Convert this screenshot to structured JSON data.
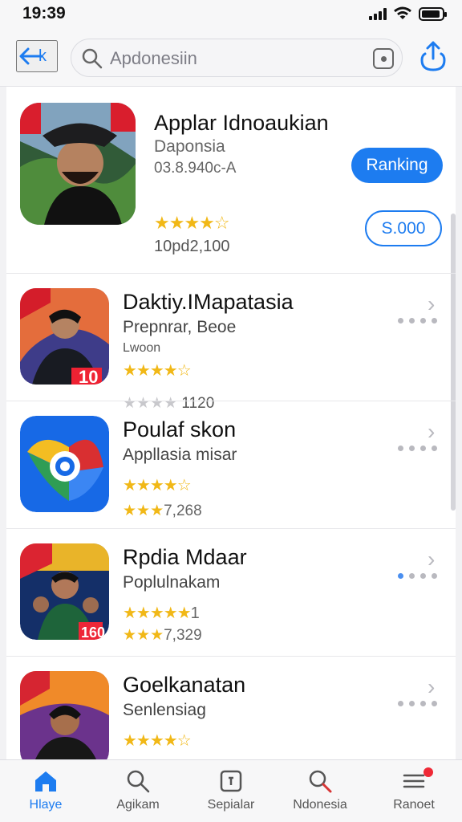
{
  "status_bar": {
    "time": "19:39"
  },
  "nav": {
    "back_label": "k",
    "search_value": "Apdonesiin"
  },
  "featured_app": {
    "title": "Applar Idnoaukian",
    "subtitle": "Daponsia",
    "code": "03.8.940c-A",
    "stars": "★★★★☆",
    "rating_count": "10pd2,100",
    "primary_action": "Ranking",
    "secondary_action": "S.000"
  },
  "apps": [
    {
      "title": "Daktiy.IMapatasia",
      "subtitle": "Prepnrar, Beoe",
      "detail": "Lwoon",
      "stars": "★★★★☆",
      "count_stars": "★★★★",
      "count": "1120"
    },
    {
      "title": "Poulaf skon",
      "subtitle": "Appllasia misar",
      "stars": "★★★★☆",
      "count_stars": "★★★",
      "count": "7,268"
    },
    {
      "title": "Rpdia Mdaar",
      "subtitle": "Poplulnakam",
      "stars": "★★★★★",
      "stars_suffix": "1",
      "count_stars": "★★★",
      "count": "7,329"
    },
    {
      "title": "Goelkanatan",
      "subtitle": "Senlensiag",
      "stars": "★★★★☆"
    }
  ],
  "tabs": [
    {
      "label": "Hlaye"
    },
    {
      "label": "Agikam"
    },
    {
      "label": "Sepialar"
    },
    {
      "label": "Ndonesia"
    },
    {
      "label": "Ranoet"
    }
  ],
  "colors": {
    "accent": "#1d7cf0",
    "star": "#f1b817",
    "badge": "#ef2936"
  }
}
